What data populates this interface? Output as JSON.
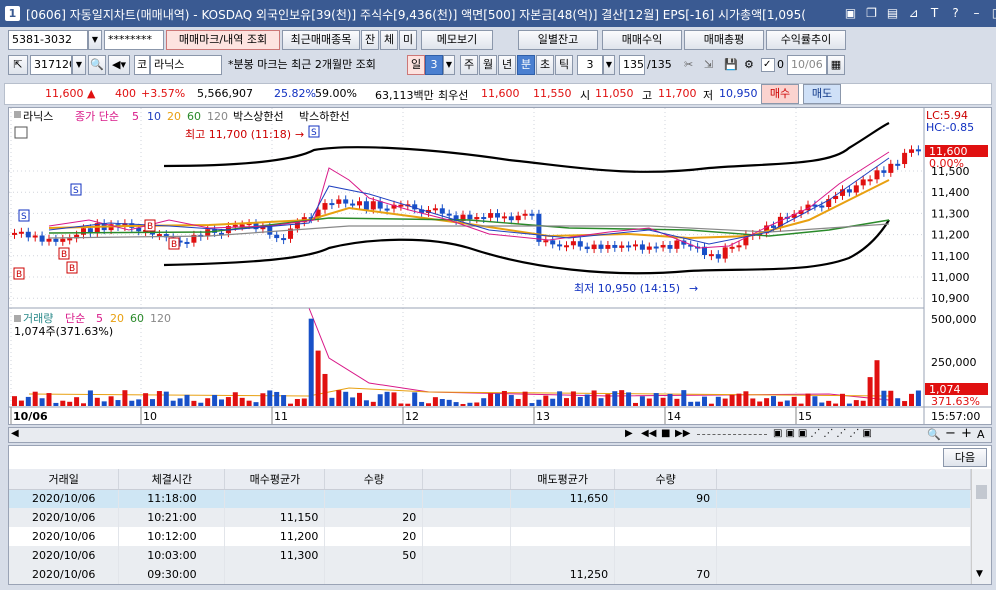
{
  "window": {
    "number": "1",
    "title": "[0606] 자동일지차트(매매내역) - KOSDAQ 외국인보유[39(천)] 주식수[9,436(천)] 액면[500] 자본금[48(억)] 결산[12월] EPS[-16] 시가총액[1,095("
  },
  "toolbar1": {
    "account": "5381-3032",
    "password": "********",
    "tab_markers": "매매마크/내역 조회",
    "recent_trades": "최근매매종목",
    "btn_jan": "잔",
    "btn_che": "체",
    "btn_mi": "미",
    "memo": "메모보기",
    "daily_balance": "일별잔고",
    "trade_profit": "매매수익",
    "trade_total": "매매총평",
    "return_trend": "수익률추이"
  },
  "toolbar2": {
    "code": "317120",
    "stock_prefix": "코",
    "stock_name": "라닉스",
    "notice": "*분봉 마크는 최근 2개월만 조회",
    "period_day": "일",
    "period_value": "3",
    "period_week": "주",
    "period_month": "월",
    "period_year": "년",
    "period_min": "분",
    "period_sec": "초",
    "period_tick": "틱",
    "tick_value": "3",
    "count_value": "135",
    "count_total": "/135",
    "check_label": "0",
    "date": "10/06"
  },
  "quote": {
    "price": "11,600",
    "arrow": "▲",
    "change": "400",
    "change_pct": "+3.57%",
    "volume": "5,566,907",
    "ratio1": "25.82%",
    "ratio2": "59.00%",
    "amount": "63,113백만",
    "best_label": "최우선",
    "best_ask": "11,600",
    "best_bid": "11,550",
    "open_label": "시",
    "open": "11,050",
    "high_label": "고",
    "high": "11,700",
    "low_label": "저",
    "low": "10,950",
    "buy": "매수",
    "sell": "매도"
  },
  "chart": {
    "legend_name": "라닉스",
    "legend_ma": "종가 단순",
    "ma5": "5",
    "ma10": "10",
    "ma20": "20",
    "ma60": "60",
    "ma120": "120",
    "box_upper": "박스상한선",
    "box_lower": "박스하한선",
    "high_note": "최고 11,700 (11:18)",
    "low_note": "최저 10,950 (14:15)",
    "lc": "LC:5.94",
    "hc": "HC:-0.85",
    "price_tag": "11,600",
    "pct_tag": "0.00%",
    "price_axis": [
      "11,500",
      "11,400",
      "11,300",
      "11,200",
      "11,100",
      "11,000",
      "10,900"
    ],
    "vol_legend_name": "거래량",
    "vol_legend_ma": "단순",
    "vol5": "5",
    "vol20": "20",
    "vol60": "60",
    "vol120": "120",
    "vol_readout": "1,074주(371.63%)",
    "vol_axis": [
      "500,000",
      "250,000"
    ],
    "vol_tag": "1,074",
    "vol_pct_tag": "371.63%",
    "time_axis": [
      "10/06",
      "10",
      "11",
      "12",
      "13",
      "14",
      "15"
    ],
    "time_right": "15:57:00",
    "colors": {
      "up": "#e01010",
      "down": "#1850c8",
      "ma5": "#d81888",
      "ma10": "#2040c0",
      "ma20": "#e8a010",
      "ma60": "#2a8a2a",
      "ma120": "#888888",
      "box": "#000000"
    }
  },
  "table": {
    "next": "다음",
    "headers": [
      "거래일",
      "체결시간",
      "매수평균가",
      "수량",
      "",
      "매도평균가",
      "수량",
      ""
    ],
    "rows": [
      [
        "2020/10/06",
        "11:18:00",
        "",
        "",
        "",
        "11,650",
        "90",
        ""
      ],
      [
        "2020/10/06",
        "10:21:00",
        "11,150",
        "20",
        "",
        "",
        "",
        ""
      ],
      [
        "2020/10/06",
        "10:12:00",
        "11,200",
        "20",
        "",
        "",
        "",
        ""
      ],
      [
        "2020/10/06",
        "10:03:00",
        "11,300",
        "50",
        "",
        "",
        "",
        ""
      ],
      [
        "2020/10/06",
        "09:30:00",
        "",
        "",
        "",
        "11,250",
        "70",
        ""
      ]
    ]
  }
}
